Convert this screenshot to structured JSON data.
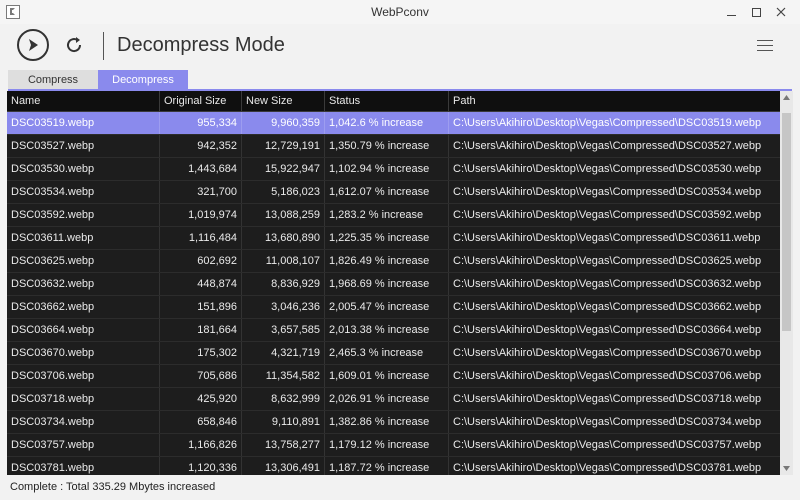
{
  "window": {
    "title": "WebPconv"
  },
  "toolbar": {
    "mode_title": "Decompress Mode"
  },
  "tabs": [
    {
      "label": "Compress",
      "active": false
    },
    {
      "label": "Decompress",
      "active": true
    }
  ],
  "columns": [
    "Name",
    "Original Size",
    "New Size",
    "Status",
    "Path"
  ],
  "rows": [
    {
      "name": "DSC03519.webp",
      "original": "955,334",
      "new": "9,960,359",
      "status": "1,042.6 % increase",
      "path": "C:\\Users\\Akihiro\\Desktop\\Vegas\\Compressed\\DSC03519.webp",
      "selected": true
    },
    {
      "name": "DSC03527.webp",
      "original": "942,352",
      "new": "12,729,191",
      "status": "1,350.79 % increase",
      "path": "C:\\Users\\Akihiro\\Desktop\\Vegas\\Compressed\\DSC03527.webp"
    },
    {
      "name": "DSC03530.webp",
      "original": "1,443,684",
      "new": "15,922,947",
      "status": "1,102.94 % increase",
      "path": "C:\\Users\\Akihiro\\Desktop\\Vegas\\Compressed\\DSC03530.webp"
    },
    {
      "name": "DSC03534.webp",
      "original": "321,700",
      "new": "5,186,023",
      "status": "1,612.07 % increase",
      "path": "C:\\Users\\Akihiro\\Desktop\\Vegas\\Compressed\\DSC03534.webp"
    },
    {
      "name": "DSC03592.webp",
      "original": "1,019,974",
      "new": "13,088,259",
      "status": "1,283.2 % increase",
      "path": "C:\\Users\\Akihiro\\Desktop\\Vegas\\Compressed\\DSC03592.webp"
    },
    {
      "name": "DSC03611.webp",
      "original": "1,116,484",
      "new": "13,680,890",
      "status": "1,225.35 % increase",
      "path": "C:\\Users\\Akihiro\\Desktop\\Vegas\\Compressed\\DSC03611.webp"
    },
    {
      "name": "DSC03625.webp",
      "original": "602,692",
      "new": "11,008,107",
      "status": "1,826.49 % increase",
      "path": "C:\\Users\\Akihiro\\Desktop\\Vegas\\Compressed\\DSC03625.webp"
    },
    {
      "name": "DSC03632.webp",
      "original": "448,874",
      "new": "8,836,929",
      "status": "1,968.69 % increase",
      "path": "C:\\Users\\Akihiro\\Desktop\\Vegas\\Compressed\\DSC03632.webp"
    },
    {
      "name": "DSC03662.webp",
      "original": "151,896",
      "new": "3,046,236",
      "status": "2,005.47 % increase",
      "path": "C:\\Users\\Akihiro\\Desktop\\Vegas\\Compressed\\DSC03662.webp"
    },
    {
      "name": "DSC03664.webp",
      "original": "181,664",
      "new": "3,657,585",
      "status": "2,013.38 % increase",
      "path": "C:\\Users\\Akihiro\\Desktop\\Vegas\\Compressed\\DSC03664.webp"
    },
    {
      "name": "DSC03670.webp",
      "original": "175,302",
      "new": "4,321,719",
      "status": "2,465.3 % increase",
      "path": "C:\\Users\\Akihiro\\Desktop\\Vegas\\Compressed\\DSC03670.webp"
    },
    {
      "name": "DSC03706.webp",
      "original": "705,686",
      "new": "11,354,582",
      "status": "1,609.01 % increase",
      "path": "C:\\Users\\Akihiro\\Desktop\\Vegas\\Compressed\\DSC03706.webp"
    },
    {
      "name": "DSC03718.webp",
      "original": "425,920",
      "new": "8,632,999",
      "status": "2,026.91 % increase",
      "path": "C:\\Users\\Akihiro\\Desktop\\Vegas\\Compressed\\DSC03718.webp"
    },
    {
      "name": "DSC03734.webp",
      "original": "658,846",
      "new": "9,110,891",
      "status": "1,382.86 % increase",
      "path": "C:\\Users\\Akihiro\\Desktop\\Vegas\\Compressed\\DSC03734.webp"
    },
    {
      "name": "DSC03757.webp",
      "original": "1,166,826",
      "new": "13,758,277",
      "status": "1,179.12 % increase",
      "path": "C:\\Users\\Akihiro\\Desktop\\Vegas\\Compressed\\DSC03757.webp"
    },
    {
      "name": "DSC03781.webp",
      "original": "1,120,336",
      "new": "13,306,491",
      "status": "1,187.72 % increase",
      "path": "C:\\Users\\Akihiro\\Desktop\\Vegas\\Compressed\\DSC03781.webp"
    }
  ],
  "status": {
    "text": "Complete : Total 335.29 Mbytes increased"
  },
  "colors": {
    "accent": "#8a8aed",
    "grid_bg": "#1d1d1d",
    "header_bg": "#0f0f0f"
  }
}
